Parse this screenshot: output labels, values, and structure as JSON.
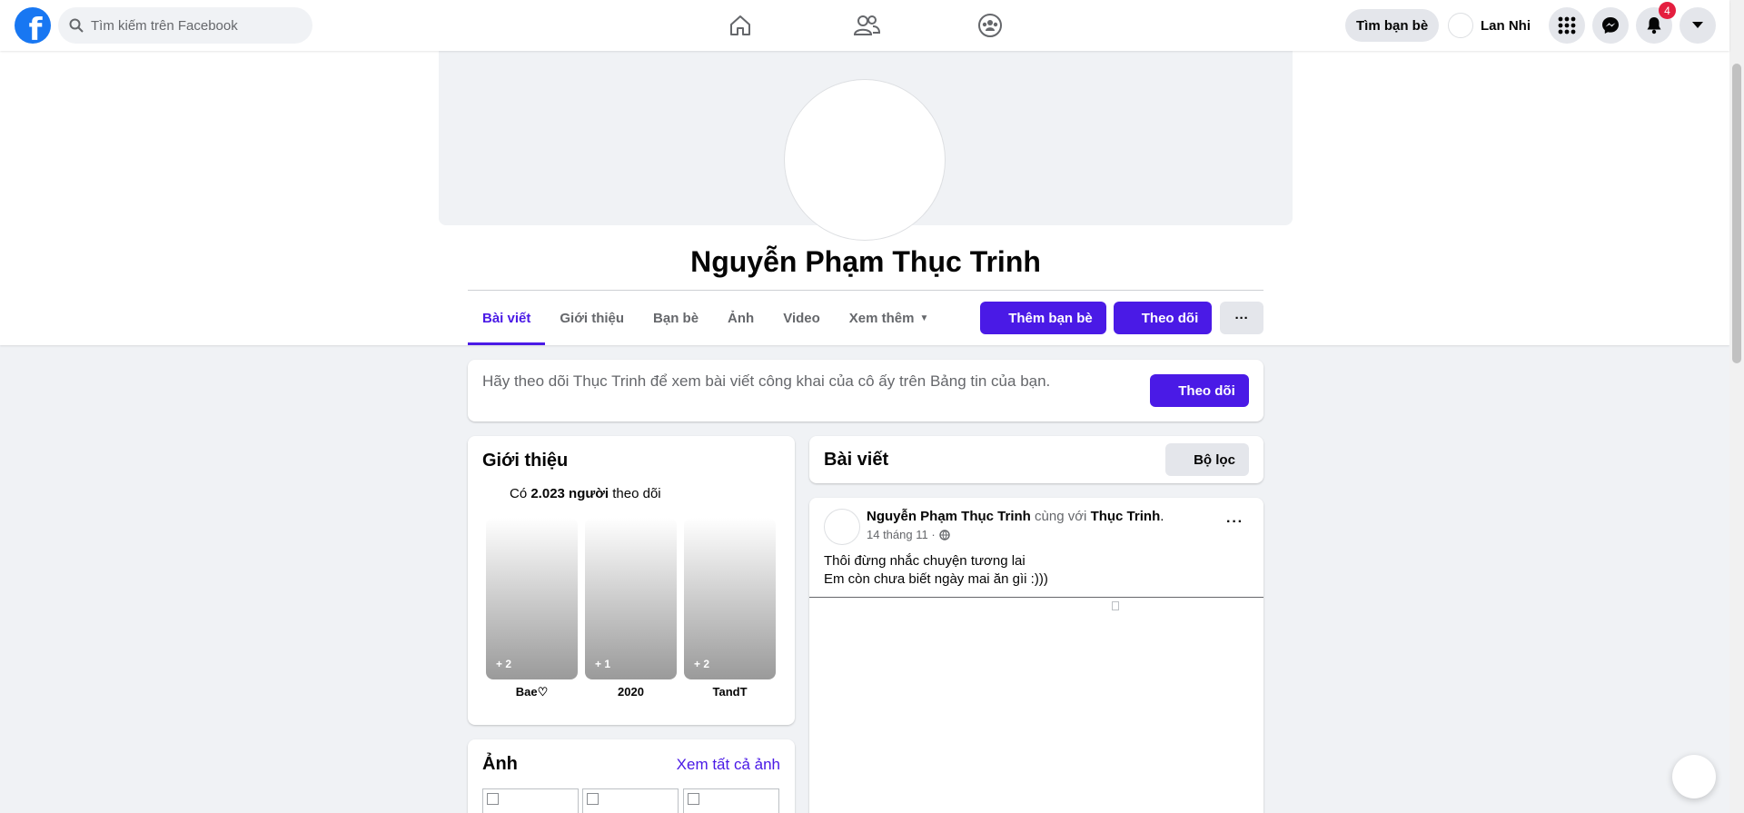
{
  "nav": {
    "search_placeholder": "Tìm kiếm trên Facebook",
    "find_friends_label": "Tìm bạn bè",
    "user_name": "Lan Nhi",
    "notification_count": "4"
  },
  "profile": {
    "name": "Nguyễn Phạm Thục Trinh",
    "tabs": [
      {
        "label": "Bài viết"
      },
      {
        "label": "Giới thiệu"
      },
      {
        "label": "Bạn bè"
      },
      {
        "label": "Ảnh"
      },
      {
        "label": "Video"
      },
      {
        "label": "Xem thêm"
      }
    ],
    "add_friend_label": "Thêm bạn bè",
    "follow_label": "Theo dõi",
    "more_label": "···"
  },
  "follow_banner": {
    "text": "Hãy theo dõi Thục Trinh để xem bài viết công khai của cô ấy trên Bảng tin của bạn.",
    "button_label": "Theo dõi"
  },
  "intro": {
    "title": "Giới thiệu",
    "followers_prefix": "Có ",
    "followers_count": "2.023 người",
    "followers_suffix": " theo dõi",
    "highlights": [
      {
        "count": "+ 2",
        "label": "Bae♡"
      },
      {
        "count": "+ 1",
        "label": "2020"
      },
      {
        "count": "+ 2",
        "label": "TandT"
      }
    ]
  },
  "photos": {
    "title": "Ảnh",
    "see_all_label": "Xem tất cả ảnh"
  },
  "posts_header": {
    "title": "Bài viết",
    "filter_label": "Bộ lọc"
  },
  "post": {
    "author": "Nguyễn Phạm Thục Trinh",
    "with_text": " cùng với ",
    "tagged": "Thục Trinh",
    "period": ".",
    "date": "14 tháng 11 ·",
    "line1": "Thôi đừng nhắc chuyện tương lai",
    "line2": "Em còn chưa biết ngày mai ăn gìi :)))"
  },
  "colors": {
    "accent": "#4a1ae6",
    "facebook_blue": "#1877f2",
    "badge_red": "#e41e3f"
  }
}
